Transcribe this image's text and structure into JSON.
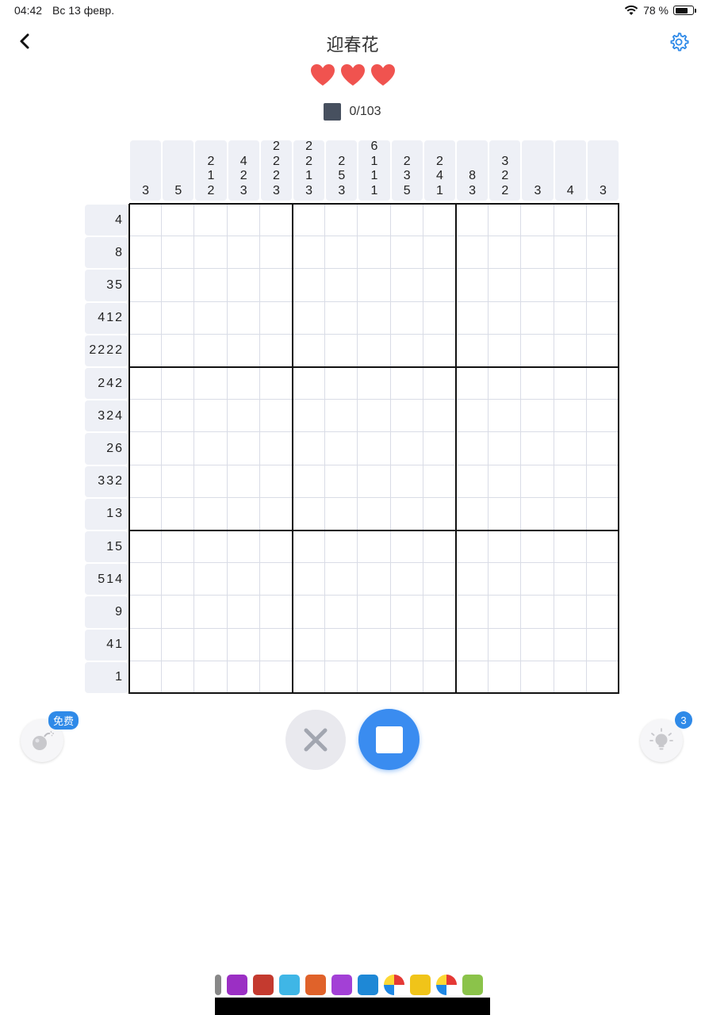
{
  "status": {
    "time": "04:42",
    "date": "Вс 13 февр.",
    "battery": "78 %",
    "battery_level": 0.78
  },
  "header": {
    "title": "迎春花"
  },
  "lives": {
    "count": 3,
    "color": "#f0534f"
  },
  "progress": {
    "text": "0/103",
    "swatch_color": "#47505f"
  },
  "puzzle": {
    "size": 15,
    "column_clues": [
      [
        "3"
      ],
      [
        "5"
      ],
      [
        "2",
        "1",
        "2"
      ],
      [
        "4",
        "2",
        "3"
      ],
      [
        "2",
        "2",
        "2",
        "3"
      ],
      [
        "2",
        "2",
        "1",
        "3"
      ],
      [
        "2",
        "5",
        "3"
      ],
      [
        "6",
        "1",
        "1",
        "1"
      ],
      [
        "2",
        "3",
        "5"
      ],
      [
        "2",
        "4",
        "1"
      ],
      [
        "8",
        "3"
      ],
      [
        "3",
        "2",
        "2"
      ],
      [
        "3"
      ],
      [
        "4"
      ],
      [
        "3"
      ]
    ],
    "row_clues": [
      "4",
      "8",
      "35",
      "412",
      "2222",
      "242",
      "324",
      "26",
      "332",
      "13",
      "15",
      "514",
      "9",
      "41",
      "1"
    ]
  },
  "controls": {
    "free_badge": "免费",
    "hint_count": "3",
    "accent_color": "#3a8cf0"
  },
  "ad": {
    "icons": [
      "app-icon",
      "purple-app-icon",
      "rubik-cube-icon",
      "blue-cube-icon",
      "orange-cube-icon",
      "purple-figure-icon",
      "blue-app-icon",
      "beach-ball-icon",
      "yellow-cube-icon",
      "beach-ball-icon",
      "green-app-icon"
    ]
  }
}
